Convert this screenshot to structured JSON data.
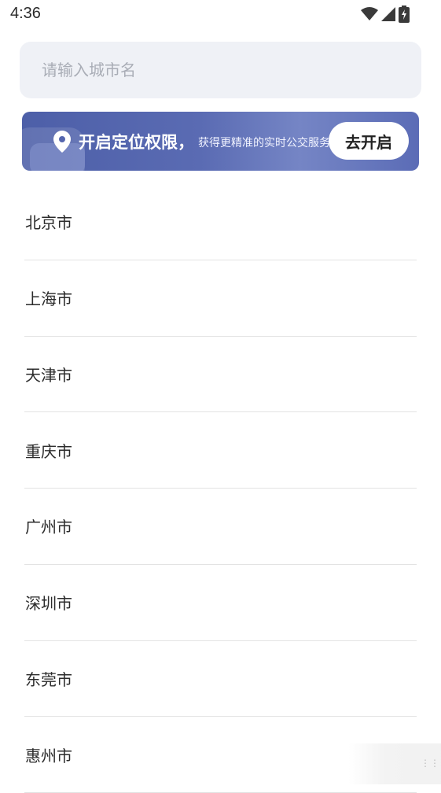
{
  "status_bar": {
    "time": "4:36",
    "icons": [
      "wifi-icon",
      "cellular-signal-icon",
      "battery-charging-icon"
    ]
  },
  "search": {
    "placeholder": "请输入城市名",
    "value": ""
  },
  "location_banner": {
    "title": "开启定位权限，",
    "subtitle": "获得更精准的实时公交服务",
    "button_label": "去开启",
    "icon": "location-pin-icon"
  },
  "cities": [
    {
      "label": "北京市"
    },
    {
      "label": "上海市"
    },
    {
      "label": "天津市"
    },
    {
      "label": "重庆市"
    },
    {
      "label": "广州市"
    },
    {
      "label": "深圳市"
    },
    {
      "label": "东莞市"
    },
    {
      "label": "惠州市"
    }
  ],
  "colors": {
    "banner_bg": "#5566ae",
    "search_bg": "#eff1f6",
    "divider": "#e3e3e3"
  }
}
